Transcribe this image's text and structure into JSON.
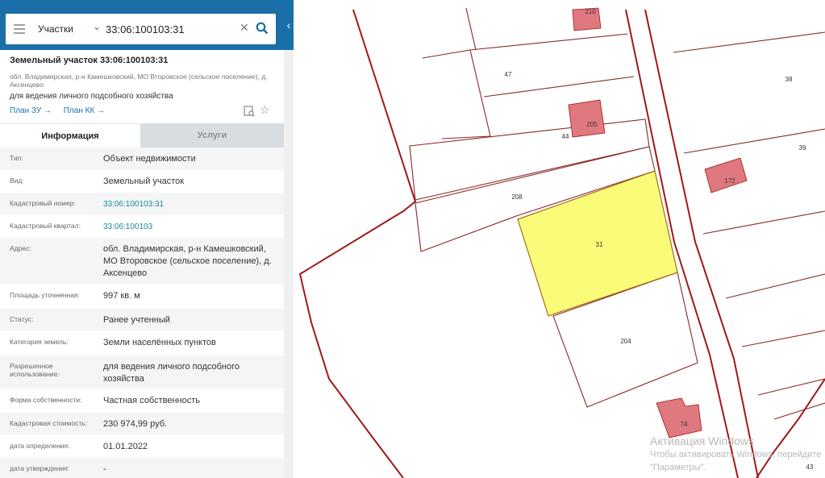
{
  "search": {
    "category": "Участки",
    "query": "33:06:100103:31"
  },
  "parcel": {
    "title": "Земельный участок 33:06:100103:31",
    "address_line": "обл. Владимирская, р-н Камешковский, МО Второвское (сельское поселение), д. Аксенцево",
    "purpose": "для ведения личного подсобного хозяйства",
    "plan_zu": "План ЗУ →",
    "plan_kk": "План КК →"
  },
  "tabs": {
    "info": "Информация",
    "services": "Услуги"
  },
  "info": [
    {
      "k": "Тип:",
      "v": "Объект недвижимости"
    },
    {
      "k": "Вид:",
      "v": "Земельный участок"
    },
    {
      "k": "Кадастровый номер:",
      "v": "33:06:100103:31"
    },
    {
      "k": "Кадастровый квартал:",
      "v": "33:06:100103"
    },
    {
      "k": "Адрес:",
      "v": "обл. Владимирская, р-н Камешковский, МО Второвское (сельское поселение), д. Аксенцево"
    },
    {
      "k": "Площадь уточненная:",
      "v": "997 кв. м"
    },
    {
      "k": "Статус:",
      "v": "Ранее учтенный"
    },
    {
      "k": "Категория земель:",
      "v": "Земли населённых пунктов"
    },
    {
      "k": "Разрешенное использование:",
      "v": "для ведения личного подсобного хозяйства"
    },
    {
      "k": "Форма собственности:",
      "v": "Частная собственность"
    },
    {
      "k": "Кадастровая стоимость:",
      "v": "230 974,99 руб."
    },
    {
      "k": "дата определения:",
      "v": "01.01.2022"
    },
    {
      "k": "дата утверждения:",
      "v": "-"
    }
  ],
  "map_labels": {
    "p210": "210",
    "p47": "47",
    "p38": "38",
    "p205": "205",
    "p44": "44",
    "p39": "39",
    "p172": "172",
    "p208": "208",
    "p31": "31",
    "p204": "204",
    "p74": "74",
    "p43": "43"
  },
  "watermark": {
    "line1": "Активация Windows",
    "line2": "Чтобы активировать Windows, перейдите",
    "line3": "\"Параметры\"."
  },
  "colors": {
    "selected_parcel": "#fbfb7a",
    "boundary": "#a01818",
    "building": "#e07880",
    "header": "#1b6fa8"
  }
}
